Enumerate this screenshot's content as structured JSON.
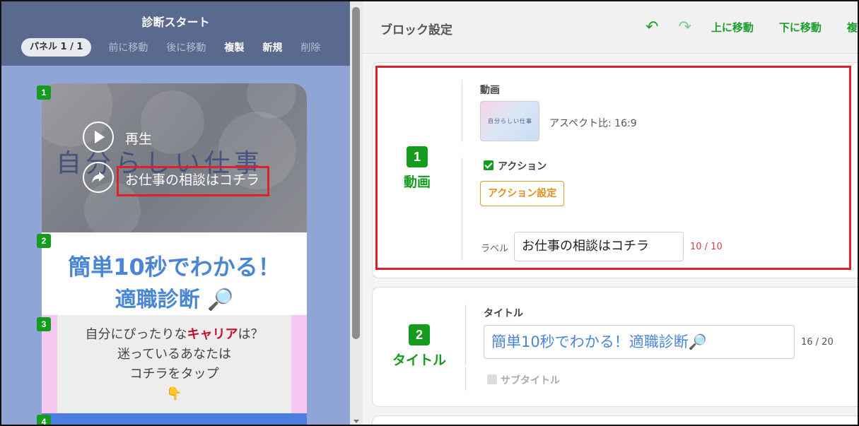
{
  "left_panel": {
    "title": "診断スタート",
    "panel_indicator": "パネル 1 / 1",
    "toolbar": {
      "move_prev": "前に移動",
      "move_next": "後に移動",
      "duplicate": "複製",
      "new": "新規",
      "delete": "削除"
    },
    "preview": {
      "video": {
        "handwritten_title": "自分らしい仕事",
        "play_label": "再生",
        "action_label": "お仕事の相談はコチラ"
      },
      "title_block": {
        "line1": "簡単10秒でわかる！",
        "line2": "適職診断",
        "emoji": "🔎"
      },
      "text_block": {
        "line1_prefix": "自分にぴったりな",
        "line1_highlight": "キャリア",
        "line1_suffix": "は？",
        "line2": "迷っているあなたは",
        "line3": "コチラをタップ",
        "emoji": "👇"
      },
      "block_numbers": [
        "1",
        "2",
        "3",
        "4"
      ]
    }
  },
  "right_panel": {
    "header": {
      "title": "ブロック設定",
      "undo_icon": "undo-icon",
      "redo_icon": "redo-icon",
      "move_up": "上に移動",
      "move_down": "下に移動"
    },
    "card1": {
      "number": "1",
      "type_label": "動画",
      "video_label": "動画",
      "thumbnail_text": "自分らしい仕事",
      "aspect": "アスペクト比: 16:9",
      "action_checkbox_label": "アクション",
      "action_checked": true,
      "action_button": "アクション設定",
      "label_caption": "ラベル",
      "label_value": "お仕事の相談はコチラ",
      "label_counter": "10 / 10"
    },
    "card2": {
      "number": "2",
      "type_label": "タイトル",
      "title_caption": "タイトル",
      "title_value": "簡単10秒でわかる！適職診断",
      "title_emoji": "🔎",
      "title_counter": "16 / 20",
      "subtitle_label": "サブタイトル",
      "subtitle_checked": false
    }
  },
  "colors": {
    "accent_green": "#159c1f",
    "highlight_red": "#e0202a",
    "title_blue": "#4a86d6",
    "action_orange": "#e0901a"
  }
}
